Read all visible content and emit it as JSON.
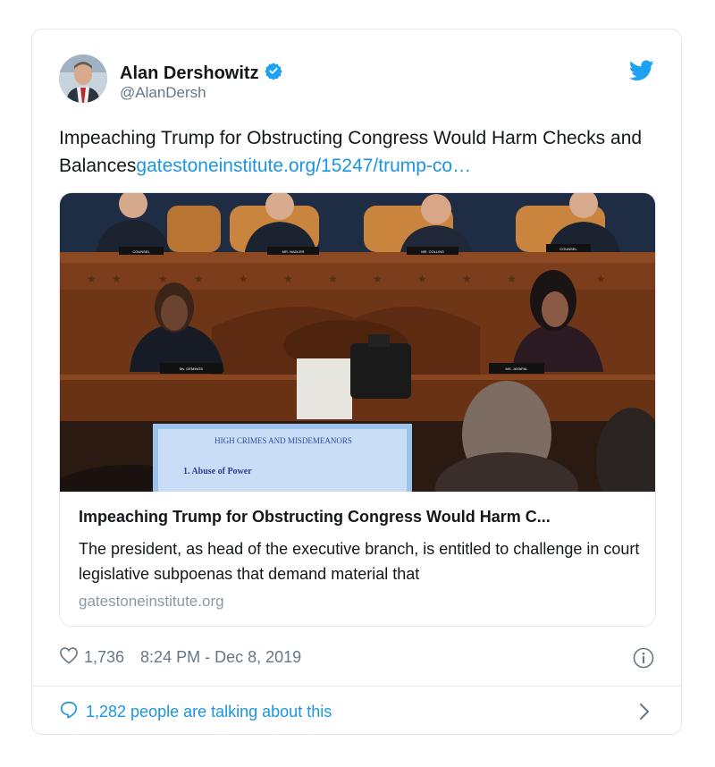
{
  "author": {
    "name": "Alan Dershowitz",
    "handle": "@AlanDersh",
    "verified": true
  },
  "tweet": {
    "text": "Impeaching Trump for Obstructing Congress Would Harm Checks and Balances",
    "link": "gatestoneinstitute.org/15247/trump-co…"
  },
  "link_card": {
    "image_screen_heading": "HIGH CRIMES AND MISDEMEANORS",
    "image_screen_item": "1.  Abuse of Power",
    "image_placards": [
      "COUNSEL",
      "MR. NADLER",
      "MR. COLLINS",
      "COUNSEL",
      "Ms. DEMINGS",
      "MS. JAYAPAL"
    ],
    "title": "Impeaching Trump for Obstructing Congress Would Harm C...",
    "description": "The president, as head of the executive branch, is entitled to challenge in court legislative subpoenas that demand material that",
    "domain": "gatestoneinstitute.org"
  },
  "meta": {
    "likes": "1,736",
    "timestamp": "8:24 PM - Dec 8, 2019"
  },
  "footer": {
    "talking": "1,282 people are talking about this"
  },
  "icons": {
    "brand": "twitter-bird-icon",
    "verified": "verified-badge-icon",
    "like": "heart-icon",
    "info": "info-icon",
    "reply": "speech-bubble-icon",
    "chevron": "chevron-right-icon"
  },
  "colors": {
    "accent": "#1b95e0",
    "text": "#14171a",
    "muted": "#657786",
    "border": "#e1e8ed"
  }
}
